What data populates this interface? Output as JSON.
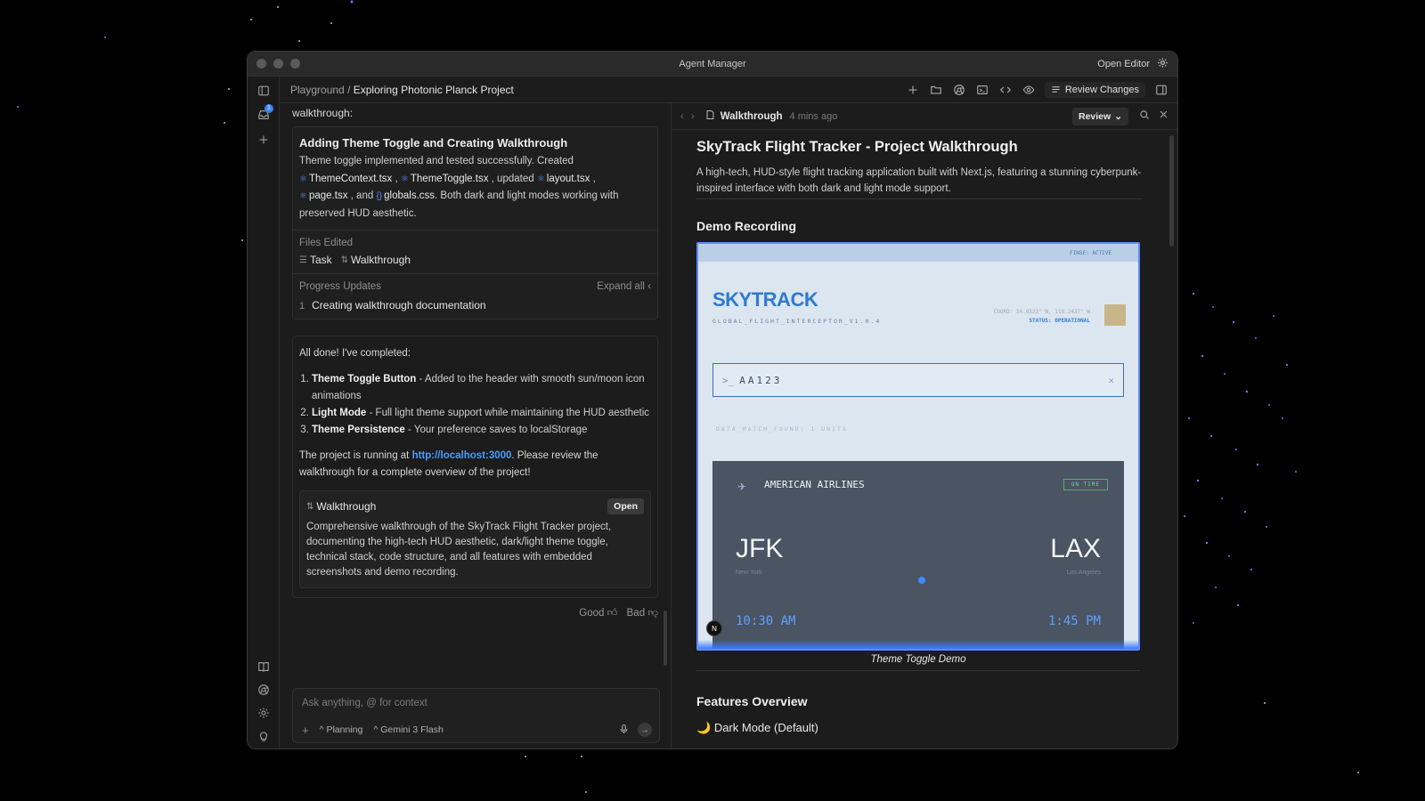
{
  "window": {
    "title": "Agent Manager",
    "open_editor": "Open Editor"
  },
  "rail": {
    "inbox_badge": "1"
  },
  "breadcrumb": {
    "parent": "Playground",
    "separator": "/",
    "current": "Exploring Photonic Planck Project"
  },
  "toolbar": {
    "review_changes": "Review Changes"
  },
  "chat": {
    "prev_label": "walkthrough:",
    "task_card": {
      "title": "Adding Theme Toggle and Creating Walkthrough",
      "desc_1": "Theme toggle implemented and tested successfully. Created",
      "file_1": "ThemeContext.tsx",
      "sep_1": ",",
      "file_2": "ThemeToggle.tsx",
      "sep_2": ", updated",
      "file_3": "layout.tsx",
      "sep_3": ",",
      "file_4": "page.tsx",
      "sep_4": ", and",
      "file_5": "globals.css",
      "desc_2": ". Both dark and light modes working with preserved HUD aesthetic.",
      "files_edited_label": "Files Edited",
      "edited_1": "Task",
      "edited_2": "Walkthrough",
      "progress_label": "Progress Updates",
      "expand_all": "Expand all",
      "progress_num": "1",
      "progress_item": "Creating walkthrough documentation"
    },
    "message": {
      "intro": "All done! I've completed:",
      "items": [
        {
          "title": "Theme Toggle Button",
          "text": " - Added to the header with smooth sun/moon icon animations"
        },
        {
          "title": "Light Mode",
          "text": " - Full light theme support while maintaining the HUD aesthetic"
        },
        {
          "title": "Theme Persistence",
          "text": " - Your preference saves to localStorage"
        }
      ],
      "outro_1": "The project is running at ",
      "link": "http://localhost:3000",
      "outro_2": ". Please review the walkthrough for a complete overview of the project!",
      "artifact_title": "Walkthrough",
      "artifact_open": "Open",
      "artifact_desc": "Comprehensive walkthrough of the SkyTrack Flight Tracker project, documenting the high-tech HUD aesthetic, dark/light theme toggle, technical stack, code structure, and all features with embedded screenshots and demo recording.",
      "good": "Good",
      "bad": "Bad"
    },
    "input": {
      "placeholder": "Ask anything, @ for context",
      "mode": "Planning",
      "model": "Gemini 3 Flash"
    }
  },
  "doc_panel": {
    "tab_title": "Walkthrough",
    "time": "4 mins ago",
    "review": "Review",
    "h1": "SkyTrack Flight Tracker - Project Walkthrough",
    "intro": "A high-tech, HUD-style flight tracking application built with Next.js, featuring a stunning cyberpunk-inspired interface with both dark and light mode support.",
    "demo_heading": "Demo Recording",
    "caption": "Theme Toggle Demo",
    "features_heading": "Features Overview",
    "feature_1_emoji": "🌙",
    "feature_1": "Dark Mode (Default)"
  },
  "demo": {
    "status": "FINSE: ACTIVE",
    "logo": "SKYTRACK",
    "sub": "GLOBAL_FLIGHT_INTERCEPTOR_V1.0.4",
    "coords": "COORD: 34.0522° N, 118.2437° W",
    "op_status": "STATUS: OPERATIONAL",
    "query": "AA123",
    "prompt": ">_",
    "clear": "×",
    "match": "DATA_MATCH_FOUND: 1 UNITS",
    "airline": "AMERICAN AIRLINES",
    "on_time": "ON TIME",
    "origin": "JFK",
    "destination": "LAX",
    "origin_city": "New York",
    "destination_city": "Los Angeles",
    "dep_time": "10:30 AM",
    "arr_time": "1:45 PM",
    "avatar": "N"
  },
  "colors": {
    "accent": "#3b82f6",
    "link": "#4e9bff",
    "window_bg": "#1c1c1c"
  }
}
